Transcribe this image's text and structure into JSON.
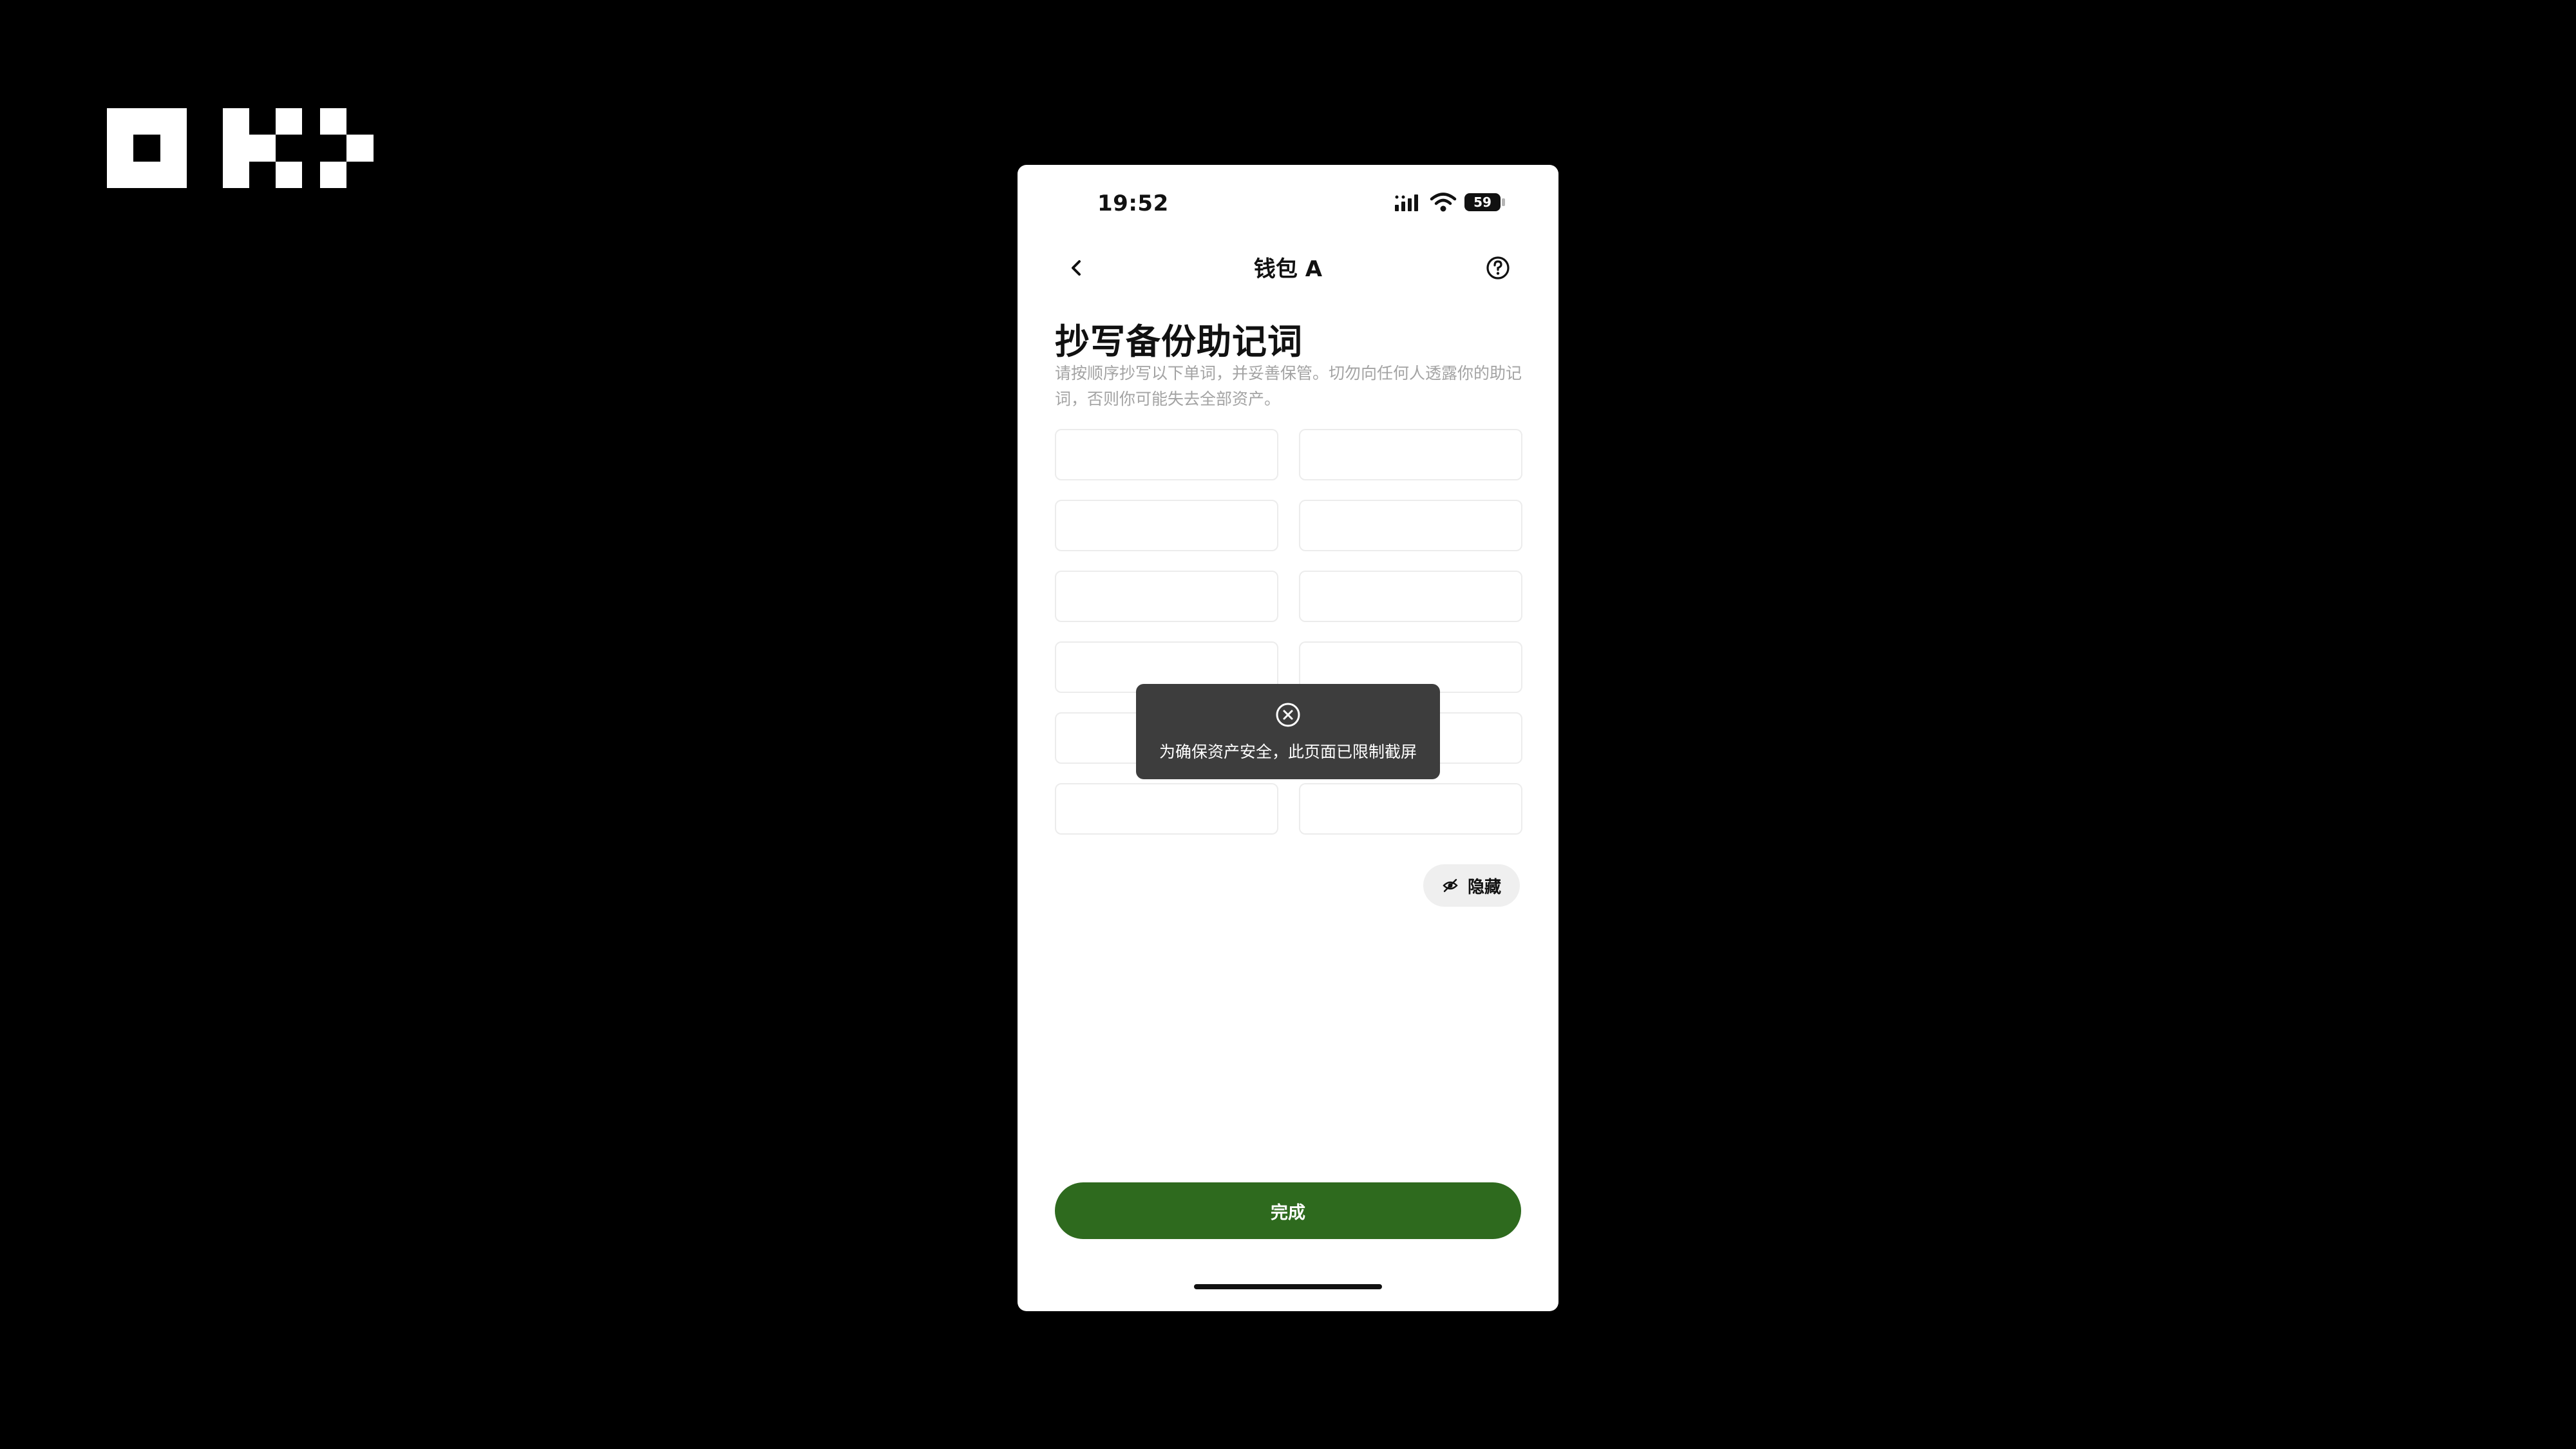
{
  "brand": {
    "logo_icon": "okx-logo-icon",
    "logo_color": "#ffffff"
  },
  "status_bar": {
    "time": "19:52",
    "battery_level": "59",
    "icons": [
      "cellular-signal-icon",
      "wifi-icon",
      "battery-icon"
    ]
  },
  "nav": {
    "back_icon": "chevron-left-icon",
    "title": "钱包 A",
    "help_icon": "question-circle-icon"
  },
  "page": {
    "title": "抄写备份助记词",
    "description": "请按顺序抄写以下单词，并妥善保管。切勿向任何人透露你的助记词，否则你可能失去全部资产。"
  },
  "mnemonic_grid": {
    "columns": 2,
    "rows": 6,
    "words": [
      "",
      "",
      "",
      "",
      "",
      "",
      "",
      "",
      "",
      "",
      "",
      ""
    ]
  },
  "toast": {
    "icon": "close-circle-icon",
    "message": "为确保资产安全，此页面已限制截屏"
  },
  "hide_button": {
    "icon": "eye-off-icon",
    "label": "隐藏"
  },
  "primary_button": {
    "label": "完成",
    "color": "#2e6a1e"
  },
  "colors": {
    "background": "#000000",
    "screen": "#ffffff",
    "toast_bg": "#3d3d3d",
    "muted_text": "#a3a3a3",
    "cell_border": "#ececec"
  }
}
